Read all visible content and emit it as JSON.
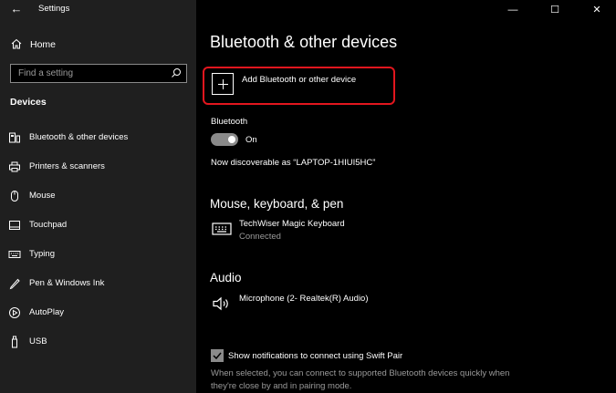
{
  "window": {
    "title": "Settings",
    "controls": {
      "minimize": "—",
      "maximize": "☐",
      "close": "✕"
    }
  },
  "sidebar": {
    "home_label": "Home",
    "search_placeholder": "Find a setting",
    "section_title": "Devices",
    "items": [
      {
        "label": "Bluetooth & other devices",
        "icon": "bluetooth-devices-icon"
      },
      {
        "label": "Printers & scanners",
        "icon": "printer-icon"
      },
      {
        "label": "Mouse",
        "icon": "mouse-icon"
      },
      {
        "label": "Touchpad",
        "icon": "touchpad-icon"
      },
      {
        "label": "Typing",
        "icon": "keyboard-icon"
      },
      {
        "label": "Pen & Windows Ink",
        "icon": "pen-icon"
      },
      {
        "label": "AutoPlay",
        "icon": "autoplay-icon"
      },
      {
        "label": "USB",
        "icon": "usb-icon"
      }
    ]
  },
  "main": {
    "title": "Bluetooth & other devices",
    "add_device_label": "Add Bluetooth or other device",
    "bluetooth_label": "Bluetooth",
    "bluetooth_state": "On",
    "discoverable_text": "Now discoverable as “LAPTOP-1HIUI5HC”",
    "sections": {
      "mouse_keyboard_pen": {
        "heading": "Mouse, keyboard, & pen",
        "device_name": "TechWiser Magic Keyboard",
        "device_status": "Connected"
      },
      "audio": {
        "heading": "Audio",
        "device_name": "Microphone (2- Realtek(R) Audio)"
      }
    },
    "swift_pair": {
      "label": "Show notifications to connect using Swift Pair",
      "checked": true,
      "description": "When selected, you can connect to supported Bluetooth devices quickly when they're close by and in pairing mode."
    }
  },
  "colors": {
    "highlight_border": "#e2161e",
    "sidebar_bg": "#1f1f1f",
    "main_bg": "#000000",
    "muted_text": "#9a9a9a"
  }
}
